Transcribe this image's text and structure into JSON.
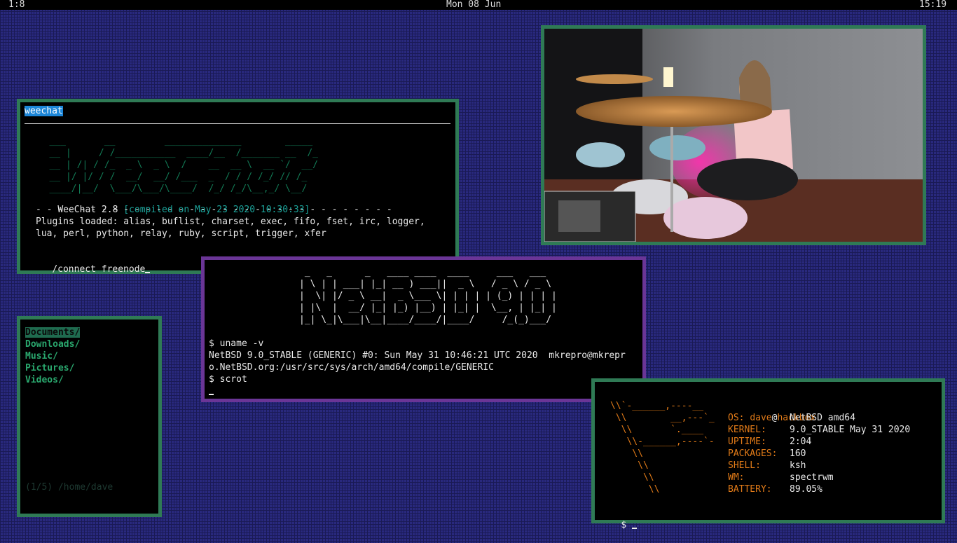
{
  "topbar": {
    "workspace": "1:8",
    "date": "Mon 08 Jun",
    "time": "15:19"
  },
  "weechat": {
    "buffer": " weechat",
    "logo_lines": [
      "   ___       __         ______________        _____",
      "   __ |     / /___________  ____/__  /_______ __  /_",
      "   __ | /| / /_  _ \\  _ \\  /    __  __ \\  __ `/  __/",
      "   __ |/ |/ / /  __/  __/ /___  _  / / / /_/ // /_",
      "   ____/|__/  \\___/\\___/\\____/  /_/ /_/\\__,_/ \\__/"
    ],
    "version": "WeeChat 2.8 ",
    "compiled": "[compiled on May 23 2020 10:30:33]",
    "separator": "- - - - - - - - - - - - - - - - - - - - - - - - - - - - - - - - -",
    "plugins_line1": "Plugins loaded: alias, buflist, charset, exec, fifo, fset, irc, logger,",
    "plugins_line2": "lua, perl, python, relay, ruby, script, trigger, xfer",
    "input": "/connect freenode"
  },
  "terminal": {
    "ascii_lines": [
      " _   _      _   ____ ____  ____     ___   ___",
      "| \\ | | ___| |_| __ ) ___||  _ \\   / _ \\ / _ \\",
      "|  \\| |/ _ \\ __|  _ \\___ \\| | | | | (_) | | | |",
      "| |\\  |  __/ |_| |_) |__) | |_| |  \\__, | |_| |",
      "|_| \\_|\\___|\\__|____/____/|____/     /_(_)___/"
    ],
    "cmd1": "$ uname -v",
    "out1": "NetBSD 9.0_STABLE (GENERIC) #0: Sun May 31 10:46:21 UTC 2020  mkrepro@mkrepr",
    "out2": "o.NetBSD.org:/usr/src/sys/arch/amd64/compile/GENERIC",
    "cmd2": "$ scrot"
  },
  "filemanager": {
    "items": [
      "Documents/",
      "Downloads/",
      "Music/",
      "Pictures/",
      "Videos/"
    ],
    "status": "(1/5) /home/dave"
  },
  "neofetch": {
    "user": "dave",
    "at": "@",
    "host": "hackbox",
    "art_lines": [
      "\\\\`-______,----__",
      " \\\\        __,---`_",
      "  \\\\       `.____",
      "   \\\\-______,----`-",
      "    \\\\",
      "     \\\\",
      "      \\\\",
      "       \\\\"
    ],
    "fields": [
      {
        "key": "OS:",
        "value": "NetBSD amd64"
      },
      {
        "key": "KERNEL:",
        "value": "9.0_STABLE May 31 2020"
      },
      {
        "key": "UPTIME:",
        "value": "2:04"
      },
      {
        "key": "PACKAGES:",
        "value": "160"
      },
      {
        "key": "SHELL:",
        "value": "ksh"
      },
      {
        "key": "WM:",
        "value": "spectrwm"
      },
      {
        "key": "BATTERY:",
        "value": "89.05%"
      }
    ],
    "prompt": "$ "
  },
  "colors": {
    "border_green": "#2f7a55",
    "border_purple": "#6a3596",
    "accent_orange": "#e07a18",
    "weechat_green": "#127a55"
  }
}
